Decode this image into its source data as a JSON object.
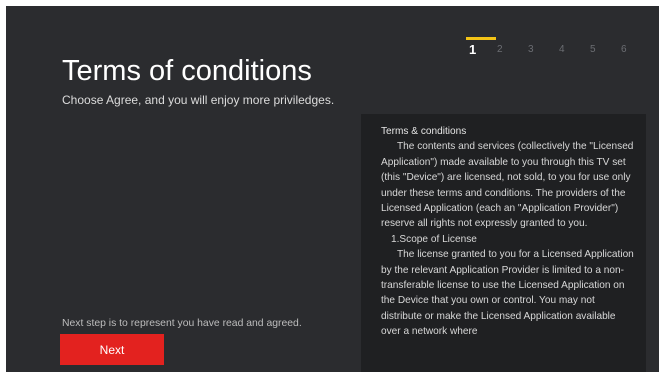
{
  "steps": [
    "1",
    "2",
    "3",
    "4",
    "5",
    "6"
  ],
  "active_step": "1",
  "title": "Terms of conditions",
  "subtitle": "Choose Agree, and you will enjoy more priviledges.",
  "terms": {
    "heading": "Terms & conditions",
    "paragraph1": "The contents and services (collectively the \"Licensed Application\") made available to you through this TV set (this \"Device\") are licensed, not sold, to you for use only under these terms and conditions. The providers of the Licensed Application (each an \"Application Provider\") reserve all rights not expressly granted to you.",
    "section1": "1.Scope of License",
    "paragraph2": "The license granted to you for a Licensed Application by the relevant Application Provider is limited to a non-transferable license to use the Licensed Application on the Device that you own or control. You may not distribute or make the Licensed Application available over a network where"
  },
  "hint": "Next step is to represent you have read and agreed.",
  "next_label": "Next",
  "colors": {
    "background": "#2b2c2f",
    "panel": "#1f2022",
    "accent_yellow": "#f3c316",
    "button_red": "#e3221f"
  }
}
